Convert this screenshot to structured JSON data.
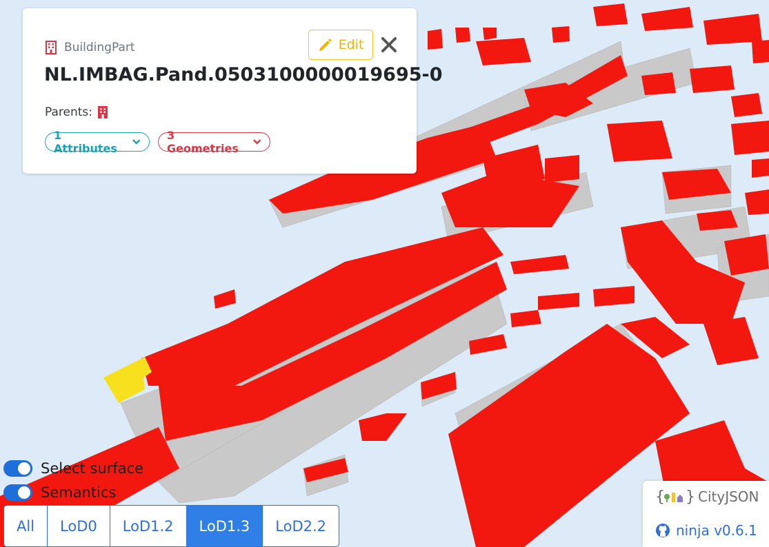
{
  "card": {
    "type_label": "BuildingPart",
    "object_id": "NL.IMBAG.Pand.0503100000019695-0",
    "edit_label": "Edit",
    "parents_label": "Parents:",
    "attributes_label": "1 Attributes",
    "geometries_label": "3 Geometries"
  },
  "toggles": {
    "select_surface": "Select surface",
    "semantics": "Semantics"
  },
  "lod": {
    "options": [
      "All",
      "LoD0",
      "LoD1.2",
      "LoD1.3",
      "LoD2.2"
    ],
    "active": "LoD1.3"
  },
  "brand": {
    "logo_text": "CityJSON",
    "link_text": "ninja v0.6.1"
  },
  "colors": {
    "roof": "#f2180f",
    "selected_roof": "#f7e11f",
    "wall": "#c6c6c6",
    "ground": "#dcebf7",
    "accent": "#2f7fe6"
  },
  "icons": [
    "building-icon",
    "pencil-icon",
    "close-icon",
    "chevron-down-icon",
    "github-icon"
  ]
}
